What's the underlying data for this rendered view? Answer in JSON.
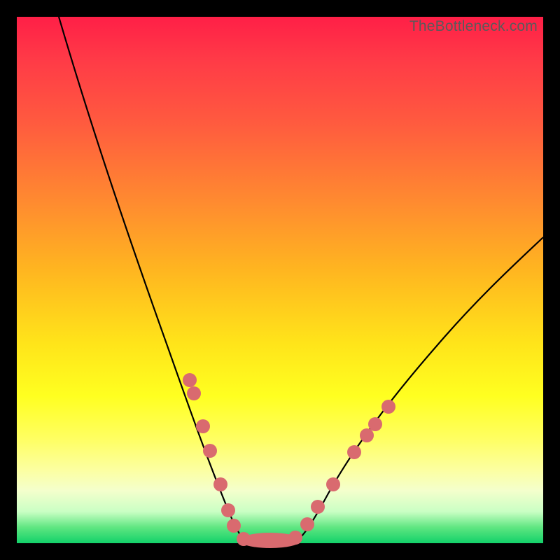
{
  "watermark": "TheBottleneck.com",
  "chart_data": {
    "type": "line",
    "title": "",
    "xlabel": "",
    "ylabel": "",
    "xlim": [
      0,
      100
    ],
    "ylim": [
      0,
      100
    ],
    "grid": false,
    "legend": false,
    "series": [
      {
        "name": "left-branch",
        "x": [
          8,
          12,
          16,
          20,
          24,
          28,
          30,
          32,
          34,
          36,
          38,
          40,
          41,
          42,
          43
        ],
        "y": [
          100,
          92,
          82,
          71,
          59,
          46,
          39,
          32,
          25,
          18,
          12,
          6,
          3,
          1,
          0
        ]
      },
      {
        "name": "right-branch",
        "x": [
          52,
          53,
          55,
          57,
          60,
          64,
          70,
          78,
          86,
          94,
          100
        ],
        "y": [
          0,
          1,
          3,
          6,
          10,
          16,
          25,
          35,
          44,
          52,
          58
        ]
      },
      {
        "name": "valley-floor",
        "x": [
          43,
          45,
          47,
          49,
          51,
          52
        ],
        "y": [
          0,
          0,
          0,
          0,
          0,
          0
        ]
      }
    ],
    "markers": {
      "note": "salmon marker dots along the curves near the valley",
      "points": [
        {
          "x": 32.5,
          "y": 31
        },
        {
          "x": 33.5,
          "y": 28
        },
        {
          "x": 35,
          "y": 22
        },
        {
          "x": 36.5,
          "y": 17
        },
        {
          "x": 38.5,
          "y": 11
        },
        {
          "x": 40,
          "y": 6
        },
        {
          "x": 41,
          "y": 3
        },
        {
          "x": 43,
          "y": 0.5
        },
        {
          "x": 45,
          "y": 0
        },
        {
          "x": 47,
          "y": 0
        },
        {
          "x": 49,
          "y": 0
        },
        {
          "x": 51,
          "y": 0
        },
        {
          "x": 53,
          "y": 1
        },
        {
          "x": 55,
          "y": 3.5
        },
        {
          "x": 57,
          "y": 7
        },
        {
          "x": 60,
          "y": 11
        },
        {
          "x": 64,
          "y": 17
        },
        {
          "x": 66.5,
          "y": 20.5
        },
        {
          "x": 68,
          "y": 22.5
        },
        {
          "x": 70.5,
          "y": 26
        }
      ]
    },
    "colors": {
      "curve": "#000000",
      "markers": "#d96a6f",
      "gradient_top": "#ff1f47",
      "gradient_mid": "#ffe41a",
      "gradient_bottom": "#12d169",
      "background": "#000000"
    }
  }
}
